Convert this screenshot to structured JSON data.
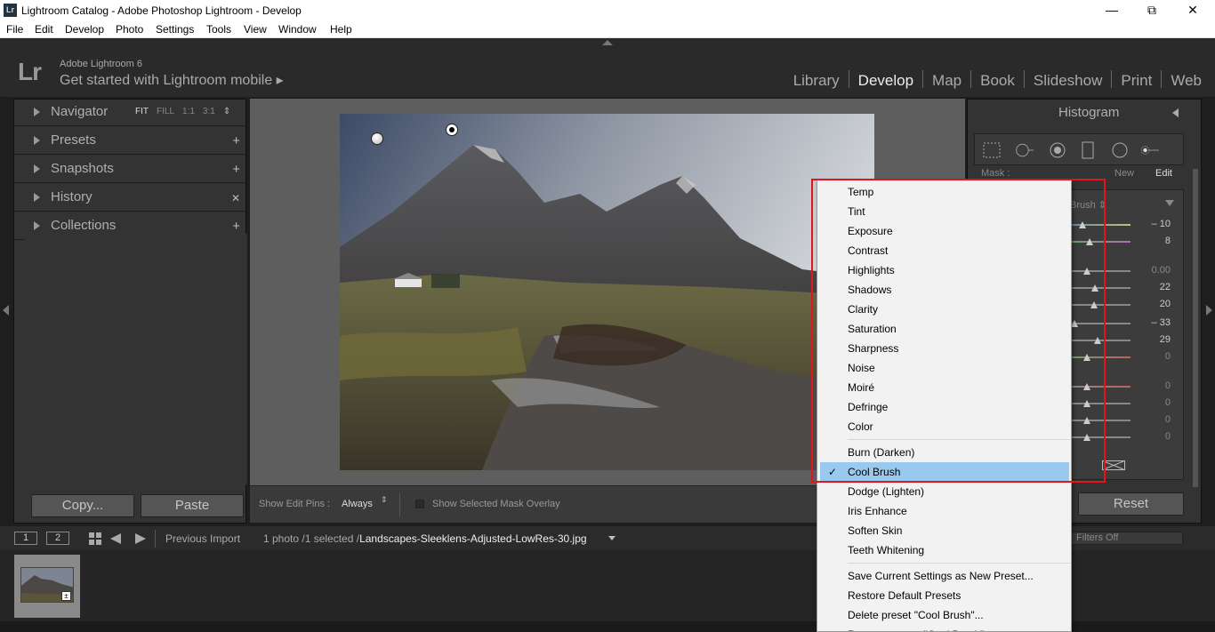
{
  "window": {
    "icon_text": "Lr",
    "title": "Lightroom Catalog - Adobe Photoshop Lightroom - Develop",
    "controls": [
      "minimize-icon",
      "restore-icon",
      "close-icon"
    ]
  },
  "menubar": [
    "File",
    "Edit",
    "Develop",
    "Photo",
    "Settings",
    "Tools",
    "View",
    "Window",
    "Help"
  ],
  "identity": {
    "logo": "Lr",
    "version": "Adobe Lightroom 6",
    "mobile": "Get started with Lightroom mobile ▸"
  },
  "modules": [
    "Library",
    "Develop",
    "Map",
    "Book",
    "Slideshow",
    "Print",
    "Web"
  ],
  "active_module": "Develop",
  "left_panel": {
    "navigator": {
      "label": "Navigator",
      "zoom": [
        "FIT",
        "FILL",
        "1:1",
        "3:1"
      ],
      "zoom_arrow": "⇕"
    },
    "presets": {
      "label": "Presets",
      "ctrl": "+"
    },
    "snapshots": {
      "label": "Snapshots",
      "ctrl": "+"
    },
    "history": {
      "label": "History",
      "ctrl": "✕"
    },
    "collections": {
      "label": "Collections",
      "ctrl": "+"
    },
    "copy": "Copy...",
    "paste": "Paste"
  },
  "toolbar": {
    "pins_label": "Show Edit Pins :",
    "pins_value": "Always",
    "pins_arrow": "⇕",
    "overlay_label": "Show Selected Mask Overlay"
  },
  "right_panel": {
    "histogram": "Histogram",
    "mask_label": "Mask :",
    "mask_new": "New",
    "mask_edit": "Edit",
    "effect_label": "Brush ⇕",
    "values": [
      "– 10",
      "8",
      "0.00",
      "22",
      "20",
      "– 33",
      "29",
      "0",
      "0",
      "0",
      "0",
      "0"
    ],
    "reset": "Reset"
  },
  "filmstrip_bar": {
    "screen1": "1",
    "screen2": "2",
    "source": "Previous Import",
    "count": "1 photo /1 selected /",
    "filename": "Landscapes-Sleeklens-Adjusted-LowRes-30.jpg",
    "filters": "Filters Off"
  },
  "menu": {
    "effects": [
      "Temp",
      "Tint",
      "Exposure",
      "Contrast",
      "Highlights",
      "Shadows",
      "Clarity",
      "Saturation",
      "Sharpness",
      "Noise",
      "Moiré",
      "Defringe",
      "Color"
    ],
    "presets": [
      "Burn (Darken)",
      "Cool Brush",
      "Dodge (Lighten)",
      "Iris Enhance",
      "Soften Skin",
      "Teeth Whitening"
    ],
    "selected": "Cool Brush",
    "check": "✓",
    "actions": [
      "Save Current Settings as New Preset...",
      "Restore Default Presets",
      "Delete preset \"Cool Brush\"...",
      "Rename preset \"Cool Brush\"..."
    ]
  }
}
